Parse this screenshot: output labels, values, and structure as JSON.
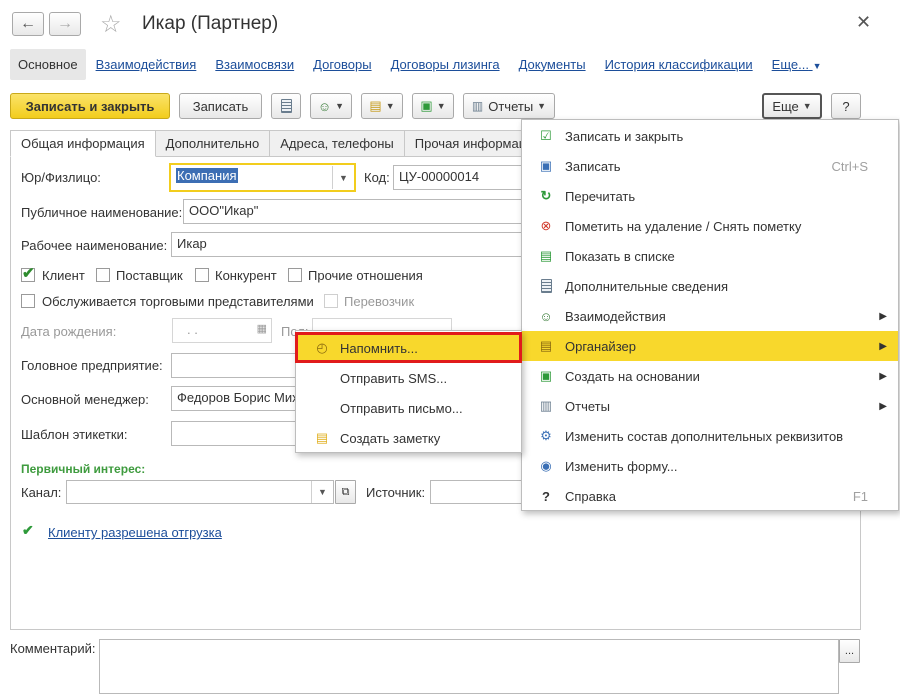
{
  "window": {
    "title": "Икар (Партнер)"
  },
  "navlinks": [
    "Основное",
    "Взаимодействия",
    "Взаимосвязи",
    "Договоры",
    "Договоры лизинга",
    "Документы",
    "История классификации",
    "Еще..."
  ],
  "toolbar": {
    "save_close": "Записать и закрыть",
    "save": "Записать",
    "reports": "Отчеты",
    "more": "Еще",
    "help": "?"
  },
  "tabs": [
    "Общая информация",
    "Дополнительно",
    "Адреса, телефоны",
    "Прочая информаци"
  ],
  "form": {
    "legal_label": "Юр/Физлицо:",
    "legal_value": "Компания",
    "code_label": "Код:",
    "code_value": "ЦУ-00000014",
    "public_label": "Публичное наименование:",
    "public_value": "ООО\"Икар\"",
    "work_label": "Рабочее наименование:",
    "work_value": "Икар",
    "cb_client": "Клиент",
    "cb_supplier": "Поставщик",
    "cb_competitor": "Конкурент",
    "cb_other": "Прочие отношения",
    "cb_served": "Обслуживается торговыми представителями",
    "cb_carrier": "Перевозчик",
    "birth_label": "Дата рождения:",
    "birth_value": ". .",
    "gender_label": "Пол:",
    "head_label": "Головное предприятие:",
    "manager_label": "Основной менеджер:",
    "manager_value": "Федоров Борис Мих",
    "template_label": "Шаблон этикетки:",
    "interest_head": "Первичный интерес:",
    "channel_label": "Канал:",
    "source_label": "Источник:",
    "shipment_link": "Клиенту разрешена отгрузка",
    "comment_label": "Комментарий:"
  },
  "more_menu": [
    {
      "label": "Записать и закрыть",
      "icon": "save-close-icon"
    },
    {
      "label": "Записать",
      "icon": "save-icon",
      "shortcut": "Ctrl+S"
    },
    {
      "label": "Перечитать",
      "icon": "refresh-icon"
    },
    {
      "label": "Пометить на удаление / Снять пометку",
      "icon": "delete-mark-icon"
    },
    {
      "label": "Показать в списке",
      "icon": "show-in-list-icon"
    },
    {
      "label": "Дополнительные сведения",
      "icon": "extra-info-icon"
    },
    {
      "label": "Взаимодействия",
      "icon": "interactions-icon",
      "submenu": true
    },
    {
      "label": "Органайзер",
      "icon": "organizer-icon",
      "submenu": true,
      "highlighted": true
    },
    {
      "label": "Создать на основании",
      "icon": "create-based-icon",
      "submenu": true
    },
    {
      "label": "Отчеты",
      "icon": "reports-icon",
      "submenu": true
    },
    {
      "label": "Изменить состав дополнительных реквизитов",
      "icon": "props-icon"
    },
    {
      "label": "Изменить форму...",
      "icon": "form-icon"
    },
    {
      "label": "Справка",
      "icon": "help-icon",
      "shortcut": "F1"
    }
  ],
  "submenu": [
    {
      "label": "Напомнить...",
      "icon": "reminder-icon",
      "highlighted": true
    },
    {
      "label": "Отправить SMS..."
    },
    {
      "label": "Отправить письмо..."
    },
    {
      "label": "Создать заметку",
      "icon": "note-icon"
    }
  ],
  "colors": {
    "accent": "#f8d82c",
    "link": "#1c4e9a",
    "highlight_border": "#e11b1b",
    "green": "#3e9b3e"
  }
}
